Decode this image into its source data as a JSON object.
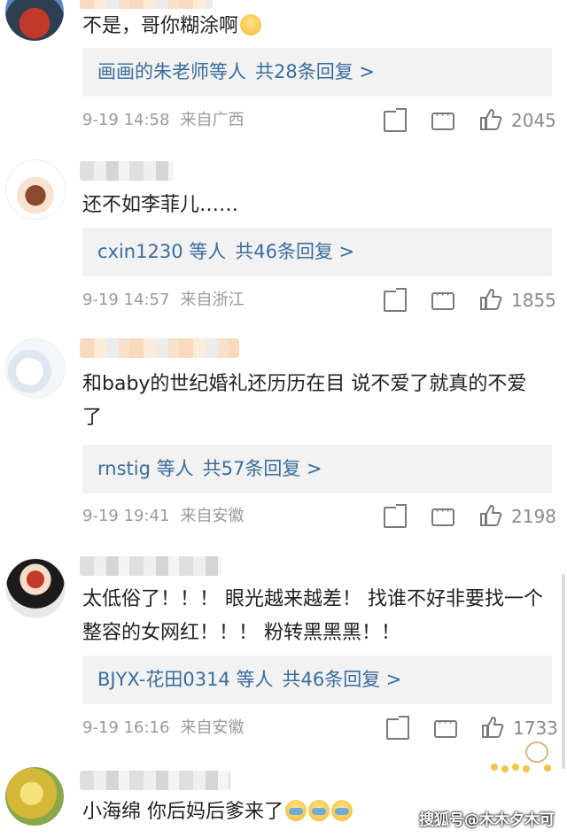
{
  "comments": [
    {
      "text": "不是，哥你糊涂啊",
      "emoji": "smile-emoji",
      "reply_users": "画画的朱老师等人",
      "reply_count": "共28条回复 >",
      "time": "9-19 14:58",
      "source": "来自广西",
      "likes": "2045"
    },
    {
      "text": "还不如李菲儿……",
      "reply_users": "cxin1230 等人",
      "reply_count": "共46条回复 >",
      "time": "9-19 14:57",
      "source": "来自浙江",
      "likes": "1855"
    },
    {
      "text": "和baby的世纪婚礼还历历在目 说不爱了就真的不爱了",
      "reply_users": "rnstig 等人",
      "reply_count": "共57条回复 >",
      "time": "9-19 19:41",
      "source": "来自安徽",
      "likes": "2198"
    },
    {
      "text": "太低俗了！！！ 眼光越来越差！ 找谁不好非要找一个整容的女网红！！！ 粉转黑黑黑！！",
      "reply_users": "BJYX-花田0314 等人",
      "reply_count": "共46条回复 >",
      "time": "9-19 16:16",
      "source": "来自安徽",
      "likes": "1733"
    },
    {
      "text": "小海绵 你后妈后爹来了",
      "emoji": "crying-emoji"
    }
  ],
  "watermark": "搜狐号@木木夕木可",
  "colors": {
    "link": "#3a6d9c",
    "meta": "#9a9a9a",
    "reply_bg": "#f2f2f2"
  }
}
